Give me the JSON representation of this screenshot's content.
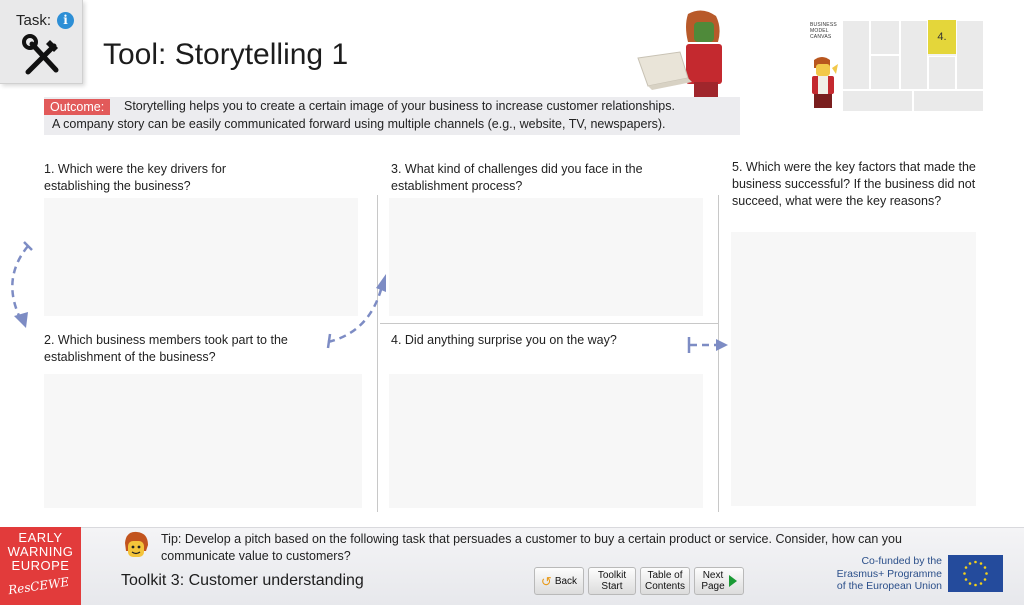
{
  "task": {
    "label": "Task:",
    "info_glyph": "i",
    "icon": "tools-icon"
  },
  "title": "Tool: Storytelling 1",
  "bmc": {
    "label": "BUSINESS MODEL CANVAS",
    "highlight": "4."
  },
  "outcome": {
    "tag": "Outcome:",
    "line1": "Storytelling helps you to create a certain image of your business to increase customer relationships.",
    "line2": "A company story can be easily communicated forward using multiple channels (e.g., website, TV, newspapers)."
  },
  "questions": {
    "q1": "1. Which were the key drivers for establishing the business?",
    "q2": "2. Which business members took part to the establishment of the business?",
    "q3": "3. What kind of challenges did you face in the establishment process?",
    "q4": "4. Did anything surprise you on the way?",
    "q5": "5. Which were the key factors that made the business successful? If the business did not succeed, what were the key reasons?"
  },
  "logo": {
    "lines": [
      "EARLY",
      "WARNING",
      "EUROPE"
    ],
    "script": "ResCEWE"
  },
  "tip": "Tip: Develop a pitch based on the following task that persuades a customer to buy a certain product or service. Consider, how can you communicate value to customers?",
  "toolkit": "Toolkit 3: Customer understanding",
  "nav": {
    "back": "Back",
    "start_l1": "Toolkit",
    "start_l2": "Start",
    "toc_l1": "Table of",
    "toc_l2": "Contents",
    "next_l1": "Next",
    "next_l2": "Page"
  },
  "cofunded": {
    "l1": "Co-funded by the",
    "l2": "Erasmus+ Programme",
    "l3": "of the European Union"
  },
  "colors": {
    "accent_red": "#e25a5a",
    "info_blue": "#2d8fd6",
    "arrow": "#7d8cc4",
    "eu_blue": "#244b9c",
    "highlight_yellow": "#e4d63a"
  }
}
